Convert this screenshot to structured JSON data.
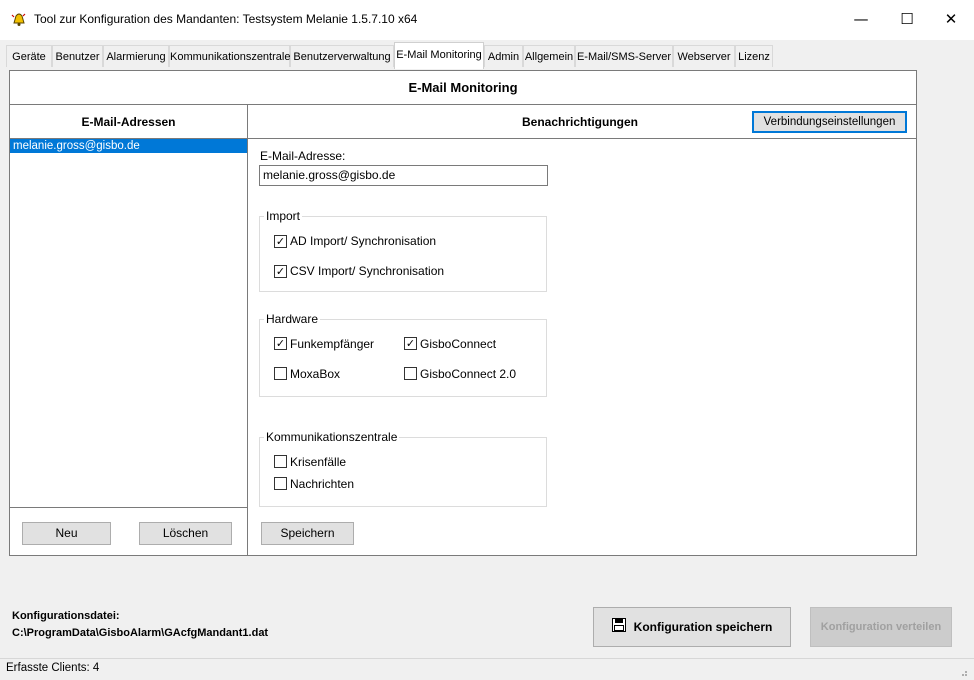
{
  "window": {
    "title": "Tool zur Konfiguration des Mandanten: Testsystem Melanie 1.5.7.10 x64",
    "minimize": "—",
    "maximize": "☐",
    "close": "✕"
  },
  "tabs": [
    {
      "label": "Geräte"
    },
    {
      "label": "Benutzer"
    },
    {
      "label": "Alarmierung"
    },
    {
      "label": "Kommunikationszentrale"
    },
    {
      "label": "Benutzerverwaltung"
    },
    {
      "label": "E-Mail Monitoring",
      "active": true
    },
    {
      "label": "Admin"
    },
    {
      "label": "Allgemein"
    },
    {
      "label": "E-Mail/SMS-Server"
    },
    {
      "label": "Webserver"
    },
    {
      "label": "Lizenz"
    }
  ],
  "panel": {
    "title": "E-Mail Monitoring",
    "left": {
      "header": "E-Mail-Adressen",
      "items": [
        "melanie.gross@gisbo.de"
      ],
      "new_label": "Neu",
      "delete_label": "Löschen"
    },
    "right": {
      "header": "Benachrichtigungen",
      "connection_settings_label": "Verbindungseinstellungen",
      "email_label": "E-Mail-Adresse:",
      "email_value": "melanie.gross@gisbo.de",
      "import": {
        "title": "Import",
        "ad": {
          "label": "AD Import/ Synchronisation",
          "checked": true
        },
        "csv": {
          "label": "CSV Import/ Synchronisation",
          "checked": true
        }
      },
      "hardware": {
        "title": "Hardware",
        "funk": {
          "label": "Funkempfänger",
          "checked": true
        },
        "gisboconnect": {
          "label": "GisboConnect",
          "checked": true
        },
        "moxabox": {
          "label": "MoxaBox",
          "checked": false
        },
        "gisboconnect2": {
          "label": "GisboConnect 2.0",
          "checked": false
        }
      },
      "kommunikation": {
        "title": "Kommunikationszentrale",
        "krisen": {
          "label": "Krisenfälle",
          "checked": false
        },
        "nachrichten": {
          "label": "Nachrichten",
          "checked": false
        }
      },
      "save_label": "Speichern"
    }
  },
  "footer": {
    "config_label": "Konfigurationsdatei:",
    "config_path": "C:\\ProgramData\\GisboAlarm\\GAcfgMandant1.dat",
    "save_config_label": "Konfiguration speichern",
    "distribute_label": "Konfiguration verteilen"
  },
  "status": {
    "text": "Erfasste Clients: 4"
  },
  "icons": {
    "app": "bell-icon",
    "save": "floppy-disk-icon"
  }
}
